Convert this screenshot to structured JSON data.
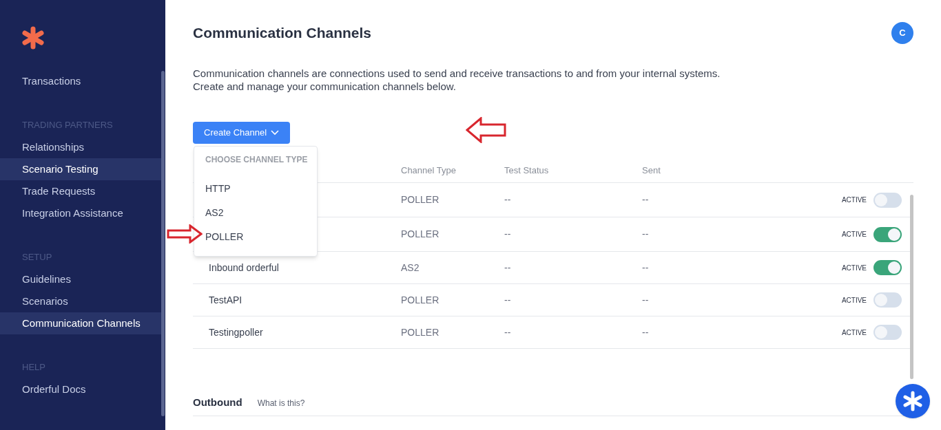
{
  "sidebar": {
    "items": [
      {
        "kind": "link",
        "label": "Transactions",
        "selected": false
      },
      {
        "kind": "heading",
        "label": "TRADING PARTNERS"
      },
      {
        "kind": "link",
        "label": "Relationships",
        "selected": false
      },
      {
        "kind": "link",
        "label": "Scenario Testing",
        "selected": true
      },
      {
        "kind": "link",
        "label": "Trade Requests",
        "selected": false
      },
      {
        "kind": "link",
        "label": "Integration Assistance",
        "selected": false
      },
      {
        "kind": "heading",
        "label": "SETUP"
      },
      {
        "kind": "link",
        "label": "Guidelines",
        "selected": false
      },
      {
        "kind": "link",
        "label": "Scenarios",
        "selected": false
      },
      {
        "kind": "link",
        "label": "Communication Channels",
        "selected": true
      },
      {
        "kind": "heading",
        "label": "HELP"
      },
      {
        "kind": "link",
        "label": "Orderful Docs",
        "selected": false
      }
    ]
  },
  "header": {
    "title": "Communication Channels",
    "avatar": "C"
  },
  "description": [
    "Communication channels are connections used to send and receive transactions to and from your internal systems.",
    "Create and manage your communication channels below."
  ],
  "create_button": {
    "label": "Create Channel",
    "expanded": true
  },
  "dropdown": {
    "heading": "CHOOSE CHANNEL TYPE",
    "options": [
      "HTTP",
      "AS2",
      "POLLER"
    ]
  },
  "table": {
    "columns": [
      "Channel Type",
      "Test Status",
      "Sent"
    ],
    "rows": [
      {
        "type": "POLLER",
        "test_status": "--",
        "sent": "--",
        "toggle_label": "ACTIVE",
        "on": false
      },
      {
        "type": "POLLER",
        "test_status": "--",
        "sent": "--",
        "toggle_label": "ACTIVE",
        "on": true
      },
      {
        "name": "Inbound orderful",
        "type": "AS2",
        "test_status": "--",
        "sent": "--",
        "toggle_label": "ACTIVE",
        "on": true
      },
      {
        "name": "TestAPI",
        "type": "POLLER",
        "test_status": "--",
        "sent": "--",
        "toggle_label": "ACTIVE",
        "on": false
      },
      {
        "name": "Testingpoller",
        "type": "POLLER",
        "test_status": "--",
        "sent": "--",
        "toggle_label": "ACTIVE",
        "on": false
      }
    ]
  },
  "outbound": {
    "title": "Outbound",
    "help_link": "What is this?"
  }
}
